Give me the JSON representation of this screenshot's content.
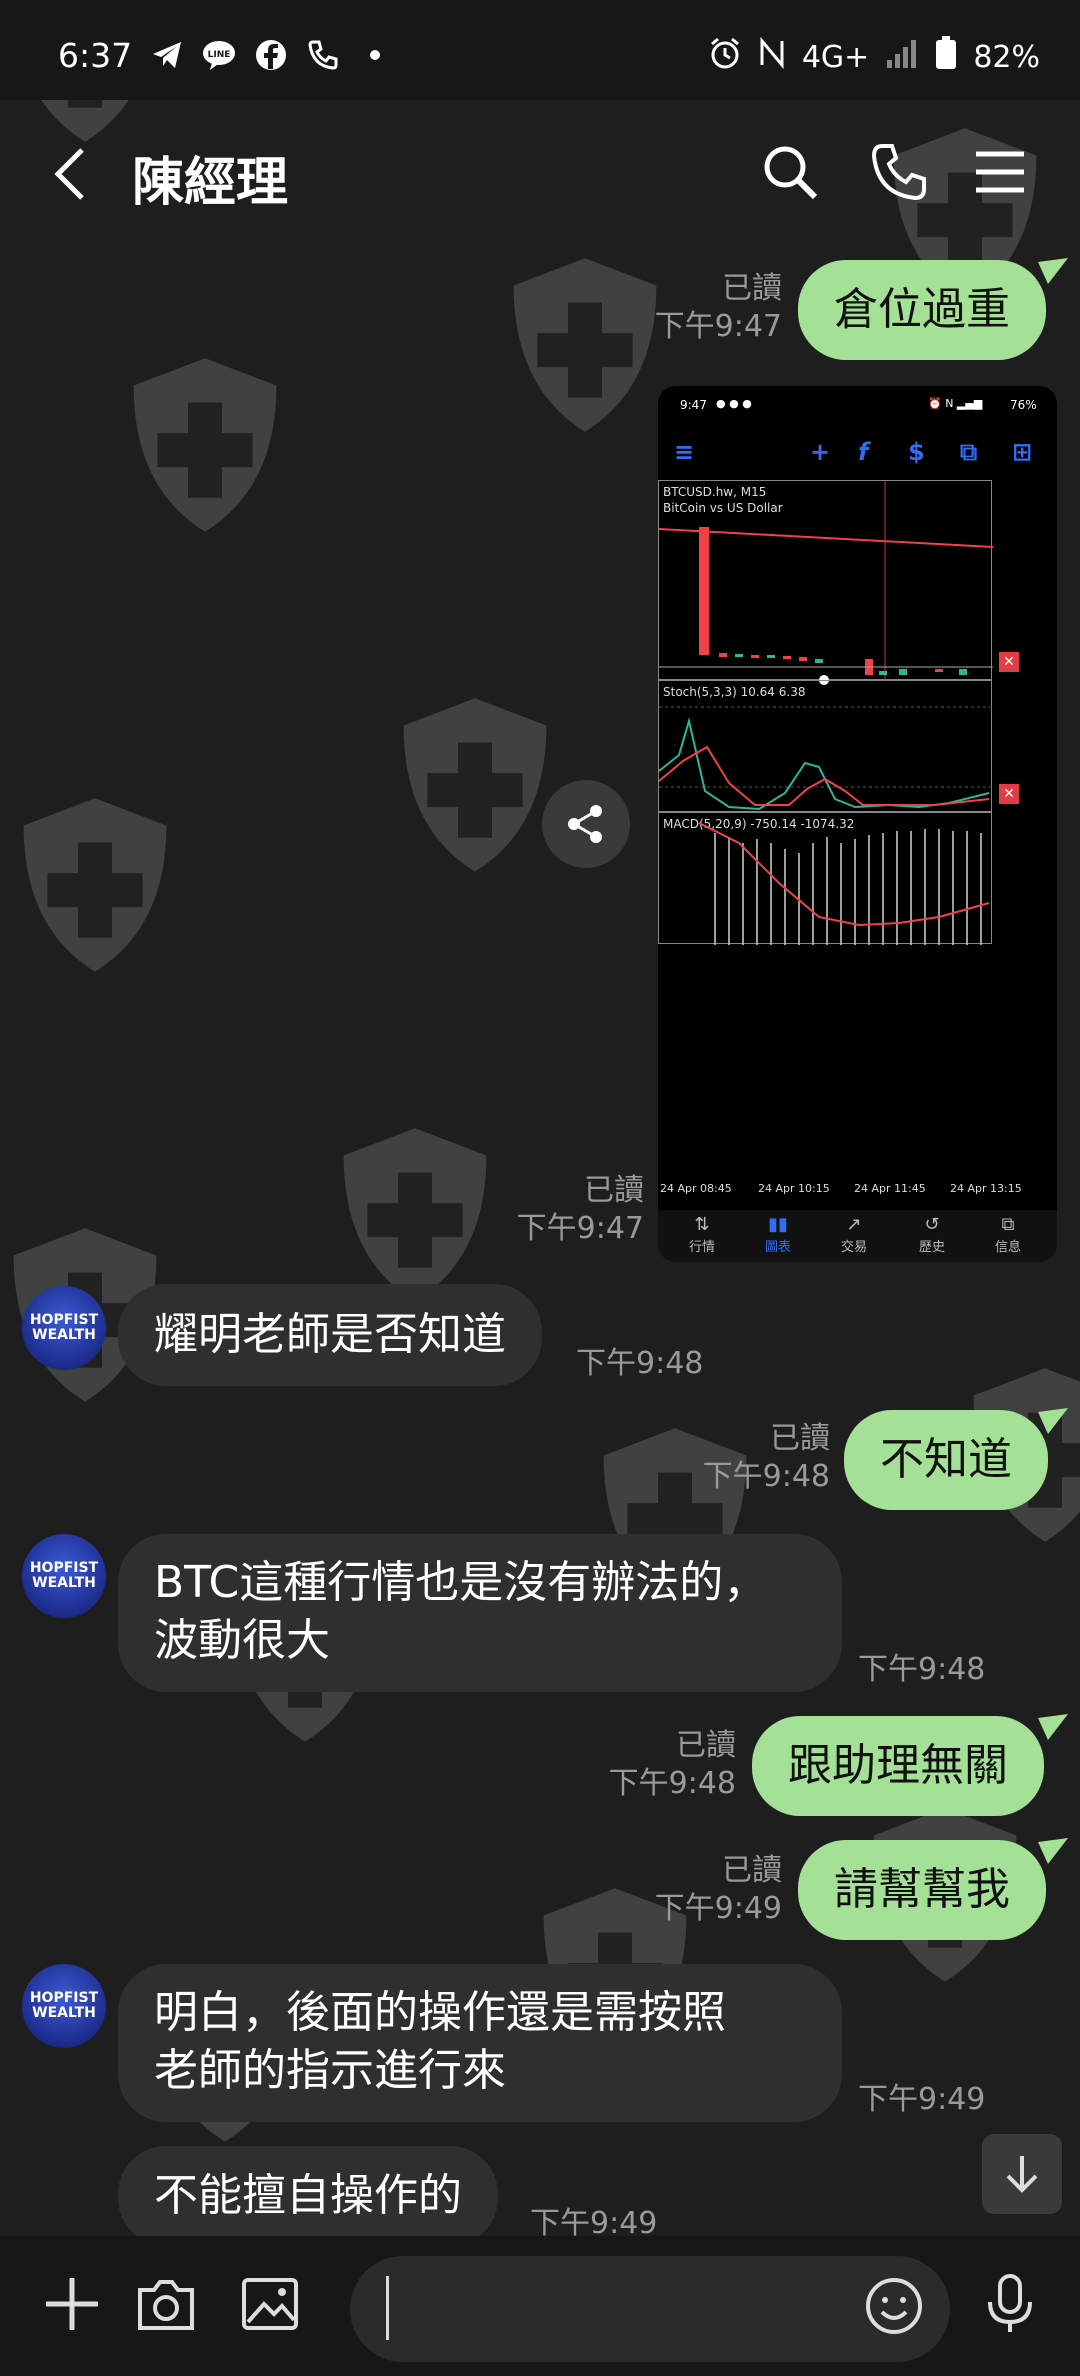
{
  "status_bar": {
    "time": "6:37",
    "network": "4G+",
    "battery": "82%",
    "icons": [
      "telegram-icon",
      "line-icon",
      "facebook-icon",
      "call-icon",
      "dot-icon",
      "alarm-icon",
      "nfc-icon",
      "signal-icon",
      "battery-icon"
    ]
  },
  "header": {
    "title": "陳經理",
    "icons": [
      "back-icon",
      "search-icon",
      "phone-icon",
      "menu-icon"
    ]
  },
  "messages": [
    {
      "side": "out",
      "text": "倉位過重",
      "read": "已讀",
      "time": "下午9:47"
    },
    {
      "side": "out",
      "type": "image",
      "read": "已讀",
      "time": "下午9:47"
    },
    {
      "side": "in",
      "text": "耀明老師是否知道",
      "time": "下午9:48"
    },
    {
      "side": "out",
      "text": "不知道",
      "read": "已讀",
      "time": "下午9:48"
    },
    {
      "side": "in",
      "text": "BTC這種行情也是沒有辦法的，波動很大",
      "line1": "BTC這種行情也是沒有辦法的，",
      "line2": "波動很大",
      "time": "下午9:48"
    },
    {
      "side": "out",
      "text": "跟助理無關",
      "read": "已讀",
      "time": "下午9:48"
    },
    {
      "side": "out",
      "text": "請幫幫我",
      "read": "已讀",
      "time": "下午9:49"
    },
    {
      "side": "in",
      "text": "明白，後面的操作還是需按照老師的指示進行來",
      "line1": "明白，後面的操作還是需按照",
      "line2": "老師的指示進行來",
      "time": "下午9:49"
    },
    {
      "side": "in",
      "text": "不能擅自操作的",
      "time": "下午9:49"
    }
  ],
  "avatar": {
    "line1": "HOPFIST",
    "line2": "WEALTH"
  },
  "screenshot": {
    "status_time": "9:47",
    "status_battery": "76%",
    "symbol": "BTCUSD.hw, M15",
    "description": "BitCoin vs US Dollar",
    "stoch_label": "Stoch(5,3,3) 10.64 6.38",
    "macd_label": "MACD(5,20,9) -750.14 -1074.32",
    "x_labels": [
      "24 Apr 08:45",
      "24 Apr 10:15",
      "24 Apr 11:45",
      "24 Apr 13:15"
    ],
    "tabs": [
      "行情",
      "圖表",
      "交易",
      "歷史",
      "信息"
    ],
    "active_tab": "圖表",
    "colors": {
      "accent": "#2f6df5",
      "bear": "#f0414b",
      "bull": "#27b89a"
    }
  },
  "input": {
    "placeholder": ""
  },
  "colors": {
    "background": "#1e1e1e",
    "out_bubble": "#a4e196",
    "in_bubble": "#2f2f2f",
    "meta_text": "#9a9a9a"
  }
}
